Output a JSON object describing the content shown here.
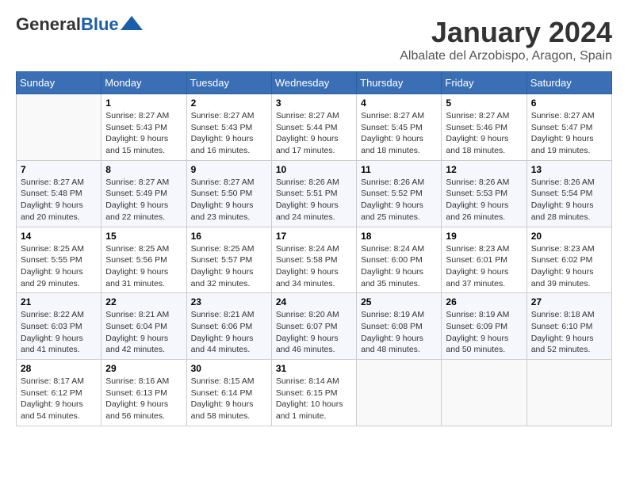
{
  "header": {
    "logo_general": "General",
    "logo_blue": "Blue",
    "month_title": "January 2024",
    "location": "Albalate del Arzobispo, Aragon, Spain"
  },
  "days_of_week": [
    "Sunday",
    "Monday",
    "Tuesday",
    "Wednesday",
    "Thursday",
    "Friday",
    "Saturday"
  ],
  "weeks": [
    [
      {
        "day": "",
        "info": ""
      },
      {
        "day": "1",
        "info": "Sunrise: 8:27 AM\nSunset: 5:43 PM\nDaylight: 9 hours\nand 15 minutes."
      },
      {
        "day": "2",
        "info": "Sunrise: 8:27 AM\nSunset: 5:43 PM\nDaylight: 9 hours\nand 16 minutes."
      },
      {
        "day": "3",
        "info": "Sunrise: 8:27 AM\nSunset: 5:44 PM\nDaylight: 9 hours\nand 17 minutes."
      },
      {
        "day": "4",
        "info": "Sunrise: 8:27 AM\nSunset: 5:45 PM\nDaylight: 9 hours\nand 18 minutes."
      },
      {
        "day": "5",
        "info": "Sunrise: 8:27 AM\nSunset: 5:46 PM\nDaylight: 9 hours\nand 18 minutes."
      },
      {
        "day": "6",
        "info": "Sunrise: 8:27 AM\nSunset: 5:47 PM\nDaylight: 9 hours\nand 19 minutes."
      }
    ],
    [
      {
        "day": "7",
        "info": "Sunrise: 8:27 AM\nSunset: 5:48 PM\nDaylight: 9 hours\nand 20 minutes."
      },
      {
        "day": "8",
        "info": "Sunrise: 8:27 AM\nSunset: 5:49 PM\nDaylight: 9 hours\nand 22 minutes."
      },
      {
        "day": "9",
        "info": "Sunrise: 8:27 AM\nSunset: 5:50 PM\nDaylight: 9 hours\nand 23 minutes."
      },
      {
        "day": "10",
        "info": "Sunrise: 8:26 AM\nSunset: 5:51 PM\nDaylight: 9 hours\nand 24 minutes."
      },
      {
        "day": "11",
        "info": "Sunrise: 8:26 AM\nSunset: 5:52 PM\nDaylight: 9 hours\nand 25 minutes."
      },
      {
        "day": "12",
        "info": "Sunrise: 8:26 AM\nSunset: 5:53 PM\nDaylight: 9 hours\nand 26 minutes."
      },
      {
        "day": "13",
        "info": "Sunrise: 8:26 AM\nSunset: 5:54 PM\nDaylight: 9 hours\nand 28 minutes."
      }
    ],
    [
      {
        "day": "14",
        "info": "Sunrise: 8:25 AM\nSunset: 5:55 PM\nDaylight: 9 hours\nand 29 minutes."
      },
      {
        "day": "15",
        "info": "Sunrise: 8:25 AM\nSunset: 5:56 PM\nDaylight: 9 hours\nand 31 minutes."
      },
      {
        "day": "16",
        "info": "Sunrise: 8:25 AM\nSunset: 5:57 PM\nDaylight: 9 hours\nand 32 minutes."
      },
      {
        "day": "17",
        "info": "Sunrise: 8:24 AM\nSunset: 5:58 PM\nDaylight: 9 hours\nand 34 minutes."
      },
      {
        "day": "18",
        "info": "Sunrise: 8:24 AM\nSunset: 6:00 PM\nDaylight: 9 hours\nand 35 minutes."
      },
      {
        "day": "19",
        "info": "Sunrise: 8:23 AM\nSunset: 6:01 PM\nDaylight: 9 hours\nand 37 minutes."
      },
      {
        "day": "20",
        "info": "Sunrise: 8:23 AM\nSunset: 6:02 PM\nDaylight: 9 hours\nand 39 minutes."
      }
    ],
    [
      {
        "day": "21",
        "info": "Sunrise: 8:22 AM\nSunset: 6:03 PM\nDaylight: 9 hours\nand 41 minutes."
      },
      {
        "day": "22",
        "info": "Sunrise: 8:21 AM\nSunset: 6:04 PM\nDaylight: 9 hours\nand 42 minutes."
      },
      {
        "day": "23",
        "info": "Sunrise: 8:21 AM\nSunset: 6:06 PM\nDaylight: 9 hours\nand 44 minutes."
      },
      {
        "day": "24",
        "info": "Sunrise: 8:20 AM\nSunset: 6:07 PM\nDaylight: 9 hours\nand 46 minutes."
      },
      {
        "day": "25",
        "info": "Sunrise: 8:19 AM\nSunset: 6:08 PM\nDaylight: 9 hours\nand 48 minutes."
      },
      {
        "day": "26",
        "info": "Sunrise: 8:19 AM\nSunset: 6:09 PM\nDaylight: 9 hours\nand 50 minutes."
      },
      {
        "day": "27",
        "info": "Sunrise: 8:18 AM\nSunset: 6:10 PM\nDaylight: 9 hours\nand 52 minutes."
      }
    ],
    [
      {
        "day": "28",
        "info": "Sunrise: 8:17 AM\nSunset: 6:12 PM\nDaylight: 9 hours\nand 54 minutes."
      },
      {
        "day": "29",
        "info": "Sunrise: 8:16 AM\nSunset: 6:13 PM\nDaylight: 9 hours\nand 56 minutes."
      },
      {
        "day": "30",
        "info": "Sunrise: 8:15 AM\nSunset: 6:14 PM\nDaylight: 9 hours\nand 58 minutes."
      },
      {
        "day": "31",
        "info": "Sunrise: 8:14 AM\nSunset: 6:15 PM\nDaylight: 10 hours\nand 1 minute."
      },
      {
        "day": "",
        "info": ""
      },
      {
        "day": "",
        "info": ""
      },
      {
        "day": "",
        "info": ""
      }
    ]
  ]
}
